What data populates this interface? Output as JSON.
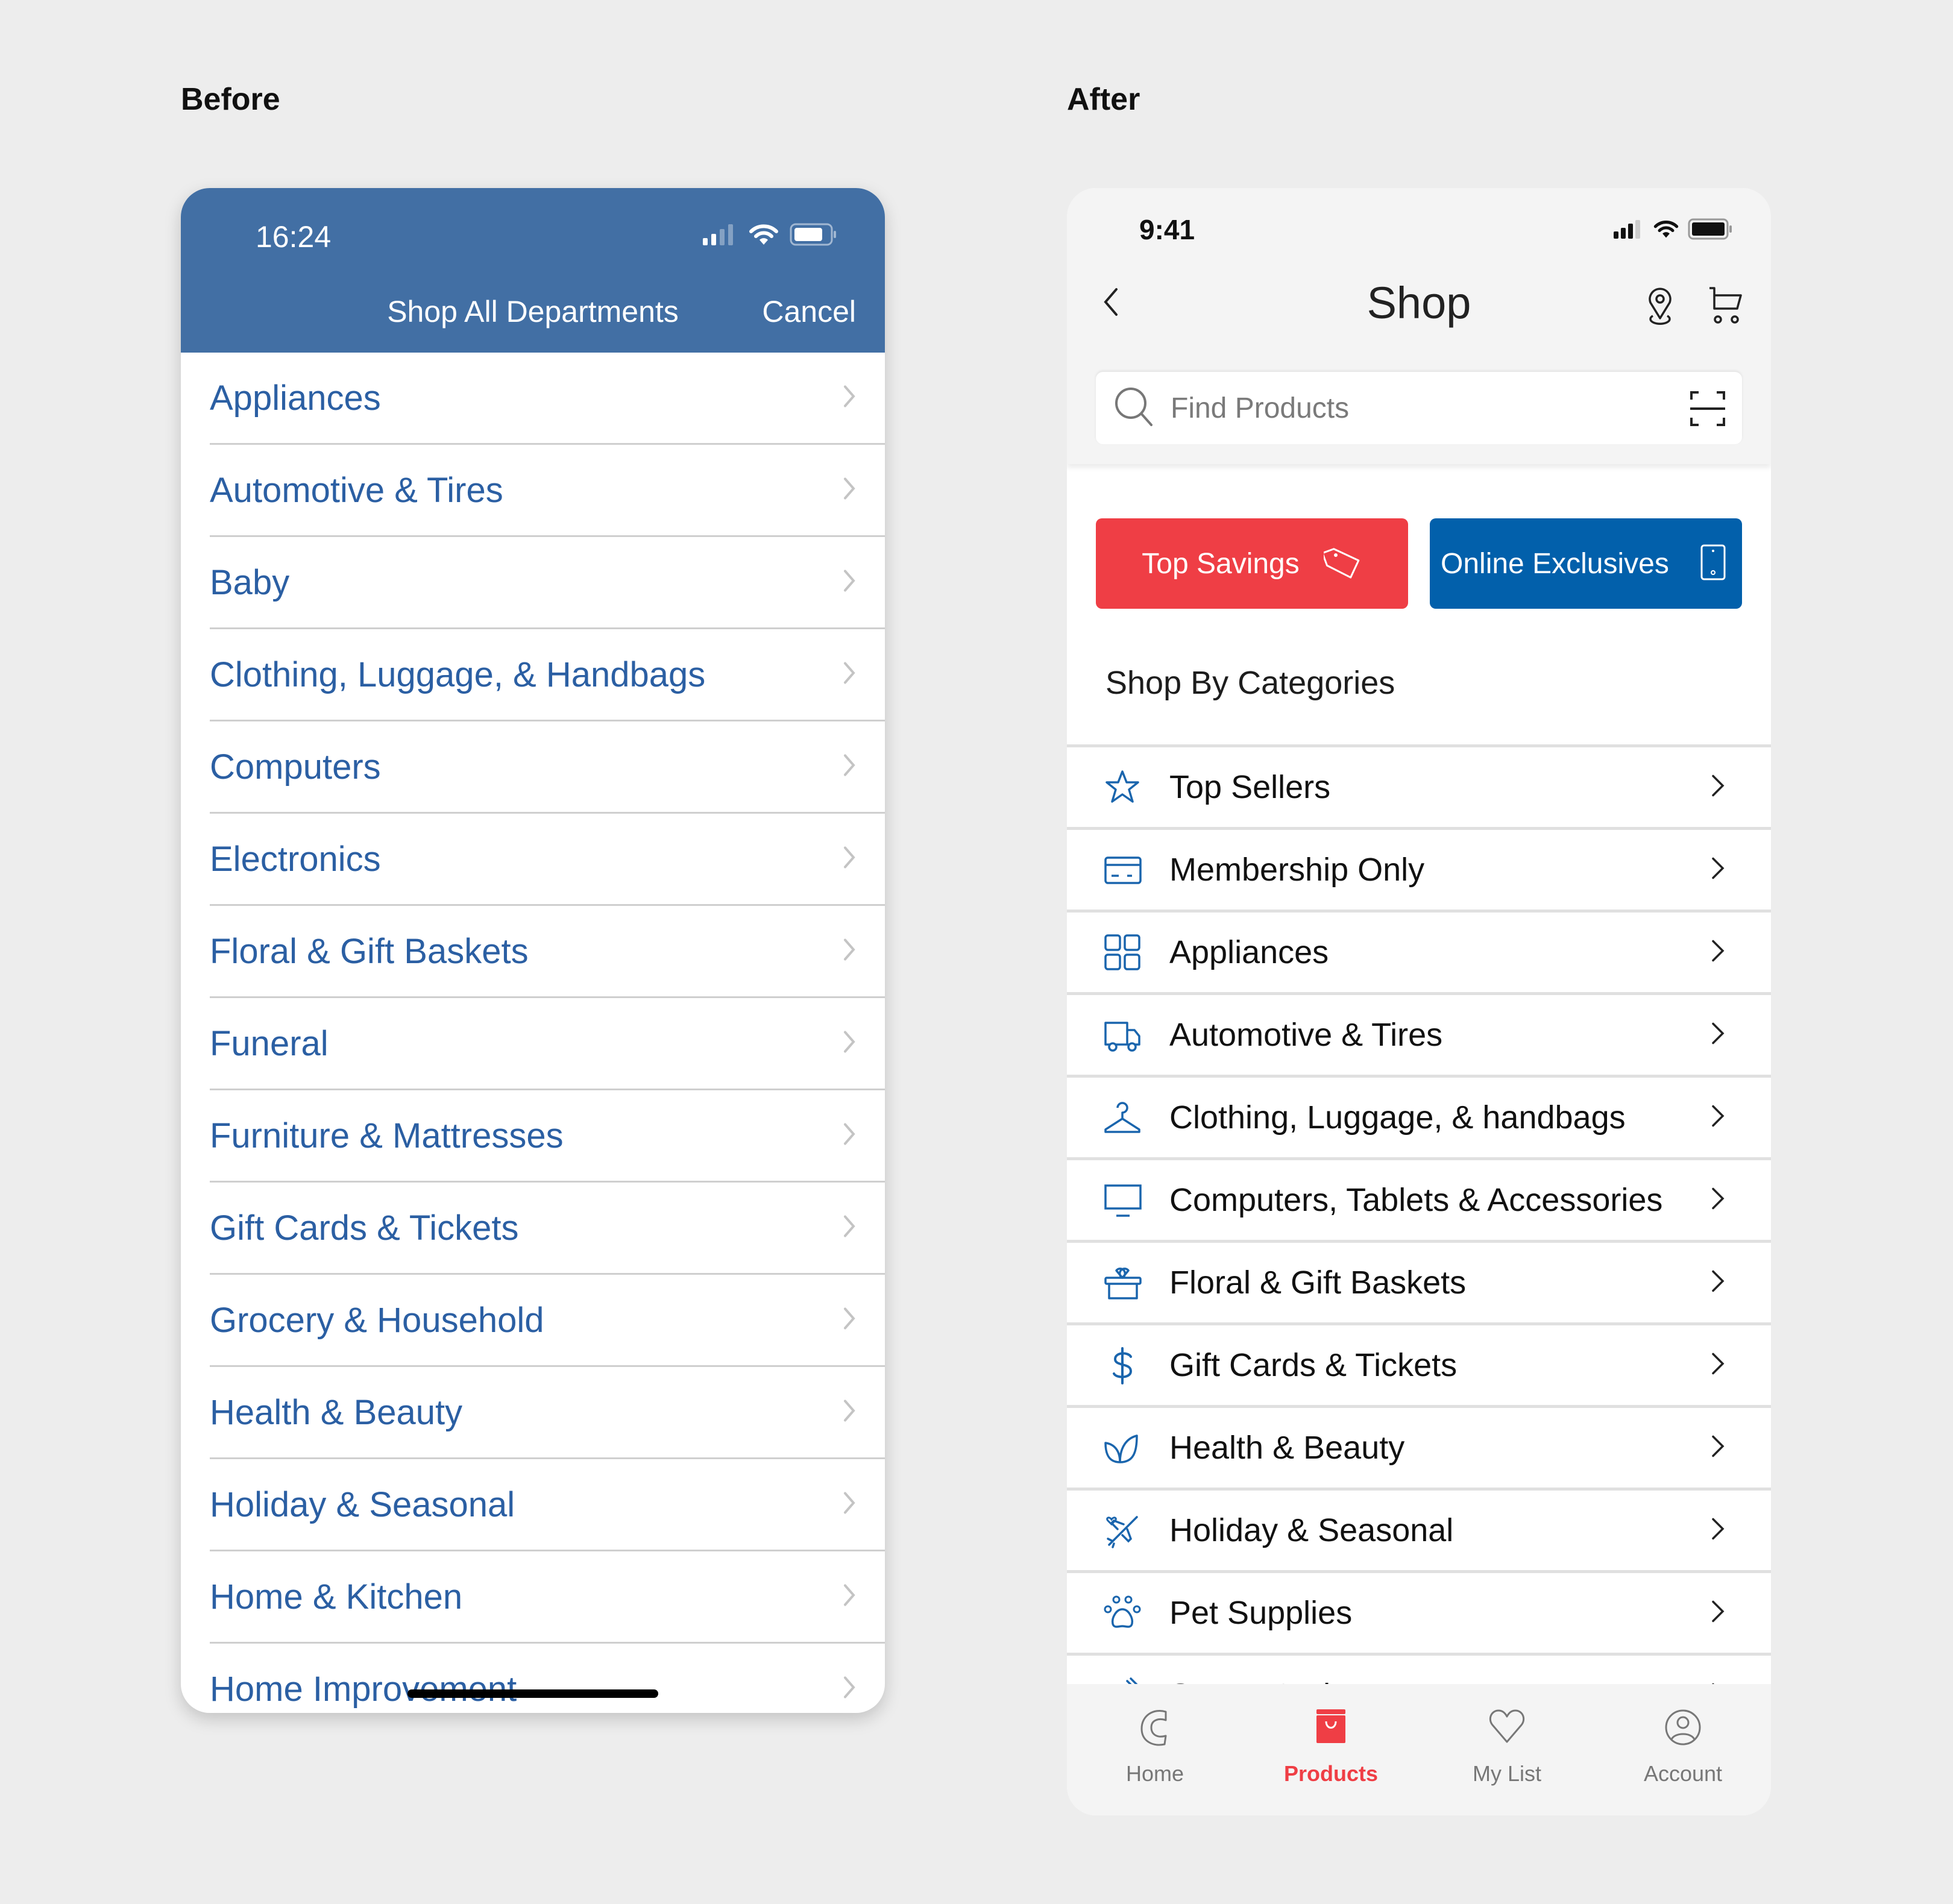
{
  "labels": {
    "before": "Before",
    "after": "After"
  },
  "before": {
    "status_time": "16:24",
    "header_title": "Shop All Departments",
    "cancel_label": "Cancel",
    "header_color": "#426fa4",
    "link_color": "#2b5fa3",
    "departments": [
      {
        "label": "Appliances"
      },
      {
        "label": "Automotive & Tires"
      },
      {
        "label": "Baby"
      },
      {
        "label": "Clothing, Luggage, & Handbags"
      },
      {
        "label": "Computers"
      },
      {
        "label": "Electronics"
      },
      {
        "label": "Floral & Gift Baskets"
      },
      {
        "label": "Funeral"
      },
      {
        "label": "Furniture & Mattresses"
      },
      {
        "label": "Gift Cards & Tickets"
      },
      {
        "label": "Grocery & Household"
      },
      {
        "label": "Health & Beauty"
      },
      {
        "label": "Holiday & Seasonal"
      },
      {
        "label": "Home & Kitchen"
      },
      {
        "label": "Home Improvement"
      }
    ]
  },
  "after": {
    "status_time": "9:41",
    "title": "Shop",
    "search": {
      "placeholder": "Find Products",
      "value": ""
    },
    "buttons": {
      "top_savings": "Top Savings",
      "online_exclusives": "Online Exclusives"
    },
    "colors": {
      "red": "#ef3e45",
      "blue": "#0260ab",
      "icon_blue": "#1a65ad"
    },
    "categories_title": "Shop By Categories",
    "categories": [
      {
        "label": "Top Sellers",
        "icon": "star-icon"
      },
      {
        "label": "Membership Only",
        "icon": "card-icon"
      },
      {
        "label": "Appliances",
        "icon": "grid-icon"
      },
      {
        "label": "Automotive & Tires",
        "icon": "truck-icon"
      },
      {
        "label": "Clothing, Luggage, & handbags",
        "icon": "hanger-icon"
      },
      {
        "label": "Computers, Tablets & Accessories",
        "icon": "monitor-icon"
      },
      {
        "label": "Floral & Gift Baskets",
        "icon": "gift-icon"
      },
      {
        "label": "Gift Cards & Tickets",
        "icon": "dollar-icon"
      },
      {
        "label": "Health & Beauty",
        "icon": "leaf-icon"
      },
      {
        "label": "Holiday & Seasonal",
        "icon": "plane-heart-icon"
      },
      {
        "label": "Pet Supplies",
        "icon": "paw-icon"
      },
      {
        "label": "Sports & Fitness",
        "icon": "dumbbell-icon"
      }
    ],
    "tabs": [
      {
        "label": "Home",
        "icon": "home-icon",
        "active": false
      },
      {
        "label": "Products",
        "icon": "bag-icon",
        "active": true
      },
      {
        "label": "My List",
        "icon": "heart-icon",
        "active": false
      },
      {
        "label": "Account",
        "icon": "account-icon",
        "active": false
      }
    ]
  }
}
